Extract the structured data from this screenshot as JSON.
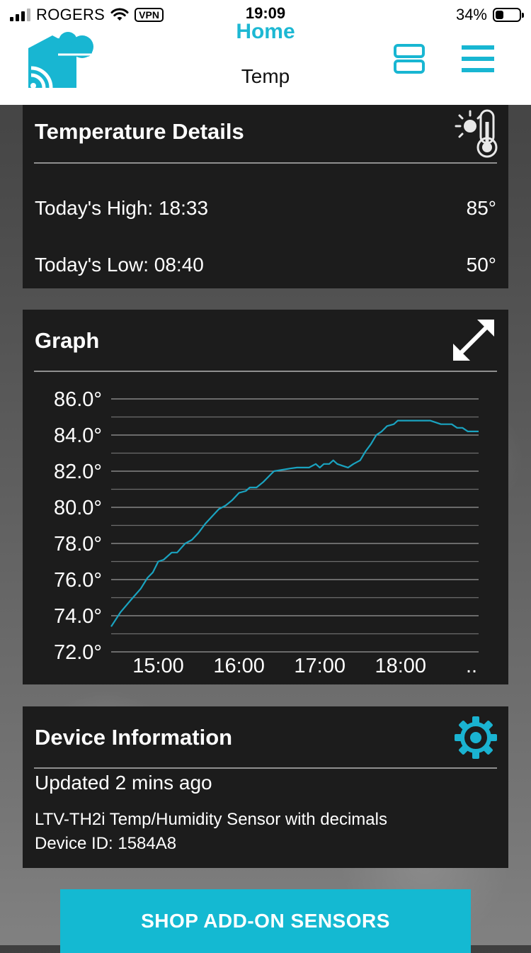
{
  "status_bar": {
    "carrier": "ROGERS",
    "vpn": "VPN",
    "time": "19:09",
    "battery": "34%",
    "battery_level": 0.34
  },
  "header": {
    "title": "Home",
    "subtitle": "Temp"
  },
  "colors": {
    "accent": "#1db8d3",
    "card_bg": "#1c1c1c",
    "chart_line": "#1aa3c0"
  },
  "icons": {
    "logo": "cloud-house-logo",
    "layout": "layout-toggle-icon",
    "menu": "hamburger-menu-icon",
    "thermometer": "thermometer-sun-icon",
    "expand": "expand-icon",
    "settings": "gear-icon"
  },
  "temperature_details": {
    "title": "Temperature Details",
    "high_label": "Today's High: 18:33",
    "high_value": "85°",
    "low_label": "Today's Low: 08:40",
    "low_value": "50°"
  },
  "graph": {
    "title": "Graph"
  },
  "chart_data": {
    "type": "line",
    "title": "",
    "xlabel": "",
    "ylabel": "",
    "ylim": [
      72,
      86
    ],
    "y_ticks": [
      "72.0°",
      "74.0°",
      "76.0°",
      "78.0°",
      "80.0°",
      "82.0°",
      "84.0°",
      "86.0°"
    ],
    "x_ticks": [
      "15:00",
      "16:00",
      "17:00",
      "18:00",
      ".."
    ],
    "grid": true,
    "series": [
      {
        "x": [
          "14:25",
          "14:32",
          "14:40",
          "14:47",
          "14:52",
          "14:56",
          "15:00",
          "15:04",
          "15:10",
          "15:14",
          "15:20",
          "15:25",
          "15:30",
          "15:35",
          "15:40",
          "15:45",
          "15:50",
          "15:55",
          "16:00",
          "16:05",
          "16:08",
          "16:13",
          "16:18",
          "16:22",
          "16:26",
          "16:30",
          "16:34",
          "16:38",
          "16:43",
          "16:47",
          "16:52",
          "16:57",
          "17:00",
          "17:03",
          "17:07",
          "17:10",
          "17:13",
          "17:17",
          "17:21",
          "17:25",
          "17:30",
          "17:34",
          "17:38",
          "17:42",
          "17:46",
          "17:50",
          "17:55",
          "17:58",
          "18:02",
          "18:06",
          "18:10",
          "18:14",
          "18:18",
          "18:22",
          "18:30",
          "18:38",
          "18:42",
          "18:46",
          "18:50",
          "18:54",
          "18:58"
        ],
        "y": [
          73.4,
          74.2,
          74.9,
          75.5,
          76.1,
          76.4,
          77.0,
          77.1,
          77.5,
          77.5,
          78.0,
          78.2,
          78.6,
          79.1,
          79.5,
          79.9,
          80.1,
          80.4,
          80.8,
          80.9,
          81.1,
          81.1,
          81.4,
          81.7,
          82.0,
          82.05,
          82.1,
          82.15,
          82.2,
          82.2,
          82.2,
          82.4,
          82.2,
          82.4,
          82.4,
          82.6,
          82.4,
          82.3,
          82.2,
          82.4,
          82.6,
          83.1,
          83.5,
          84.0,
          84.2,
          84.5,
          84.6,
          84.8,
          84.8,
          84.8,
          84.8,
          84.8,
          84.8,
          84.8,
          84.6,
          84.6,
          84.4,
          84.4,
          84.2,
          84.2,
          84.2
        ]
      }
    ]
  },
  "device_info": {
    "title": "Device Information",
    "updated": "Updated 2 mins ago",
    "model": "LTV-TH2i Temp/Humidity Sensor with decimals",
    "device_id": "Device ID: 1584A8"
  },
  "shop_button": {
    "label": "SHOP ADD-ON SENSORS"
  }
}
